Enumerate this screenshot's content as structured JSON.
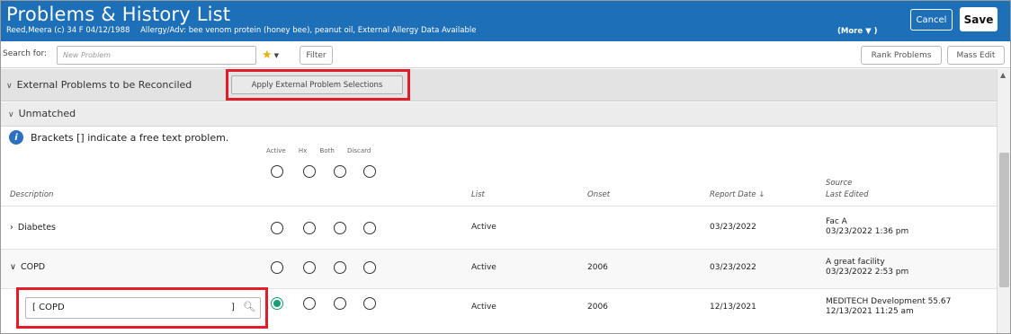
{
  "header": {
    "title": "Problems & History List",
    "patient": "Reed,Meera (c)  34  F  04/12/1988",
    "allergies": "Allergy/Adv: bee venom protein (honey bee), peanut oil, External Allergy Data Available",
    "more_label": "(More ▼ )",
    "cancel_label": "Cancel",
    "save_label": "Save",
    "bg_color": "#1d6fb8"
  },
  "search": {
    "label": "Search for:",
    "placeholder": "New Problem",
    "star_icon": "star-icon",
    "filter_label": "Filter",
    "rank_label": "Rank Problems",
    "mass_edit_label": "Mass Edit"
  },
  "external_section": {
    "label": "External Problems to be Reconciled",
    "apply_button": "Apply External Problem Selections"
  },
  "unmatched": {
    "label": "Unmatched",
    "info_text": "Brackets [] indicate a free text problem."
  },
  "columns": {
    "group_labels": [
      "Active",
      "Hx",
      "Both",
      "Discard"
    ],
    "description": "Description",
    "list": "List",
    "onset": "Onset",
    "report_date": "Report Date ↓",
    "source": "Source",
    "last_edited": "Last Edited"
  },
  "rows": [
    {
      "description": "Diabetes",
      "list": "Active",
      "onset": "",
      "report_date": "03/23/2022",
      "source": "Fac A",
      "last_edited": "03/23/2022 1:36 pm"
    },
    {
      "description": "COPD",
      "list": "Active",
      "onset": "2006",
      "report_date": "03/23/2022",
      "source": "A great facility",
      "last_edited": "03/23/2022 2:53 pm"
    },
    {
      "description": "COPD",
      "list": "Active",
      "onset": "2006",
      "report_date": "12/13/2021",
      "source": "MEDITECH Development 55.67",
      "last_edited": "12/13/2021 11:25 am",
      "selected_option": "Active"
    }
  ],
  "copd_input": {
    "open_bracket": "[",
    "value": "COPD",
    "close_bracket": "]"
  },
  "highlight_color": "#e01e2a",
  "selected_radio_color": "#1a9c74"
}
